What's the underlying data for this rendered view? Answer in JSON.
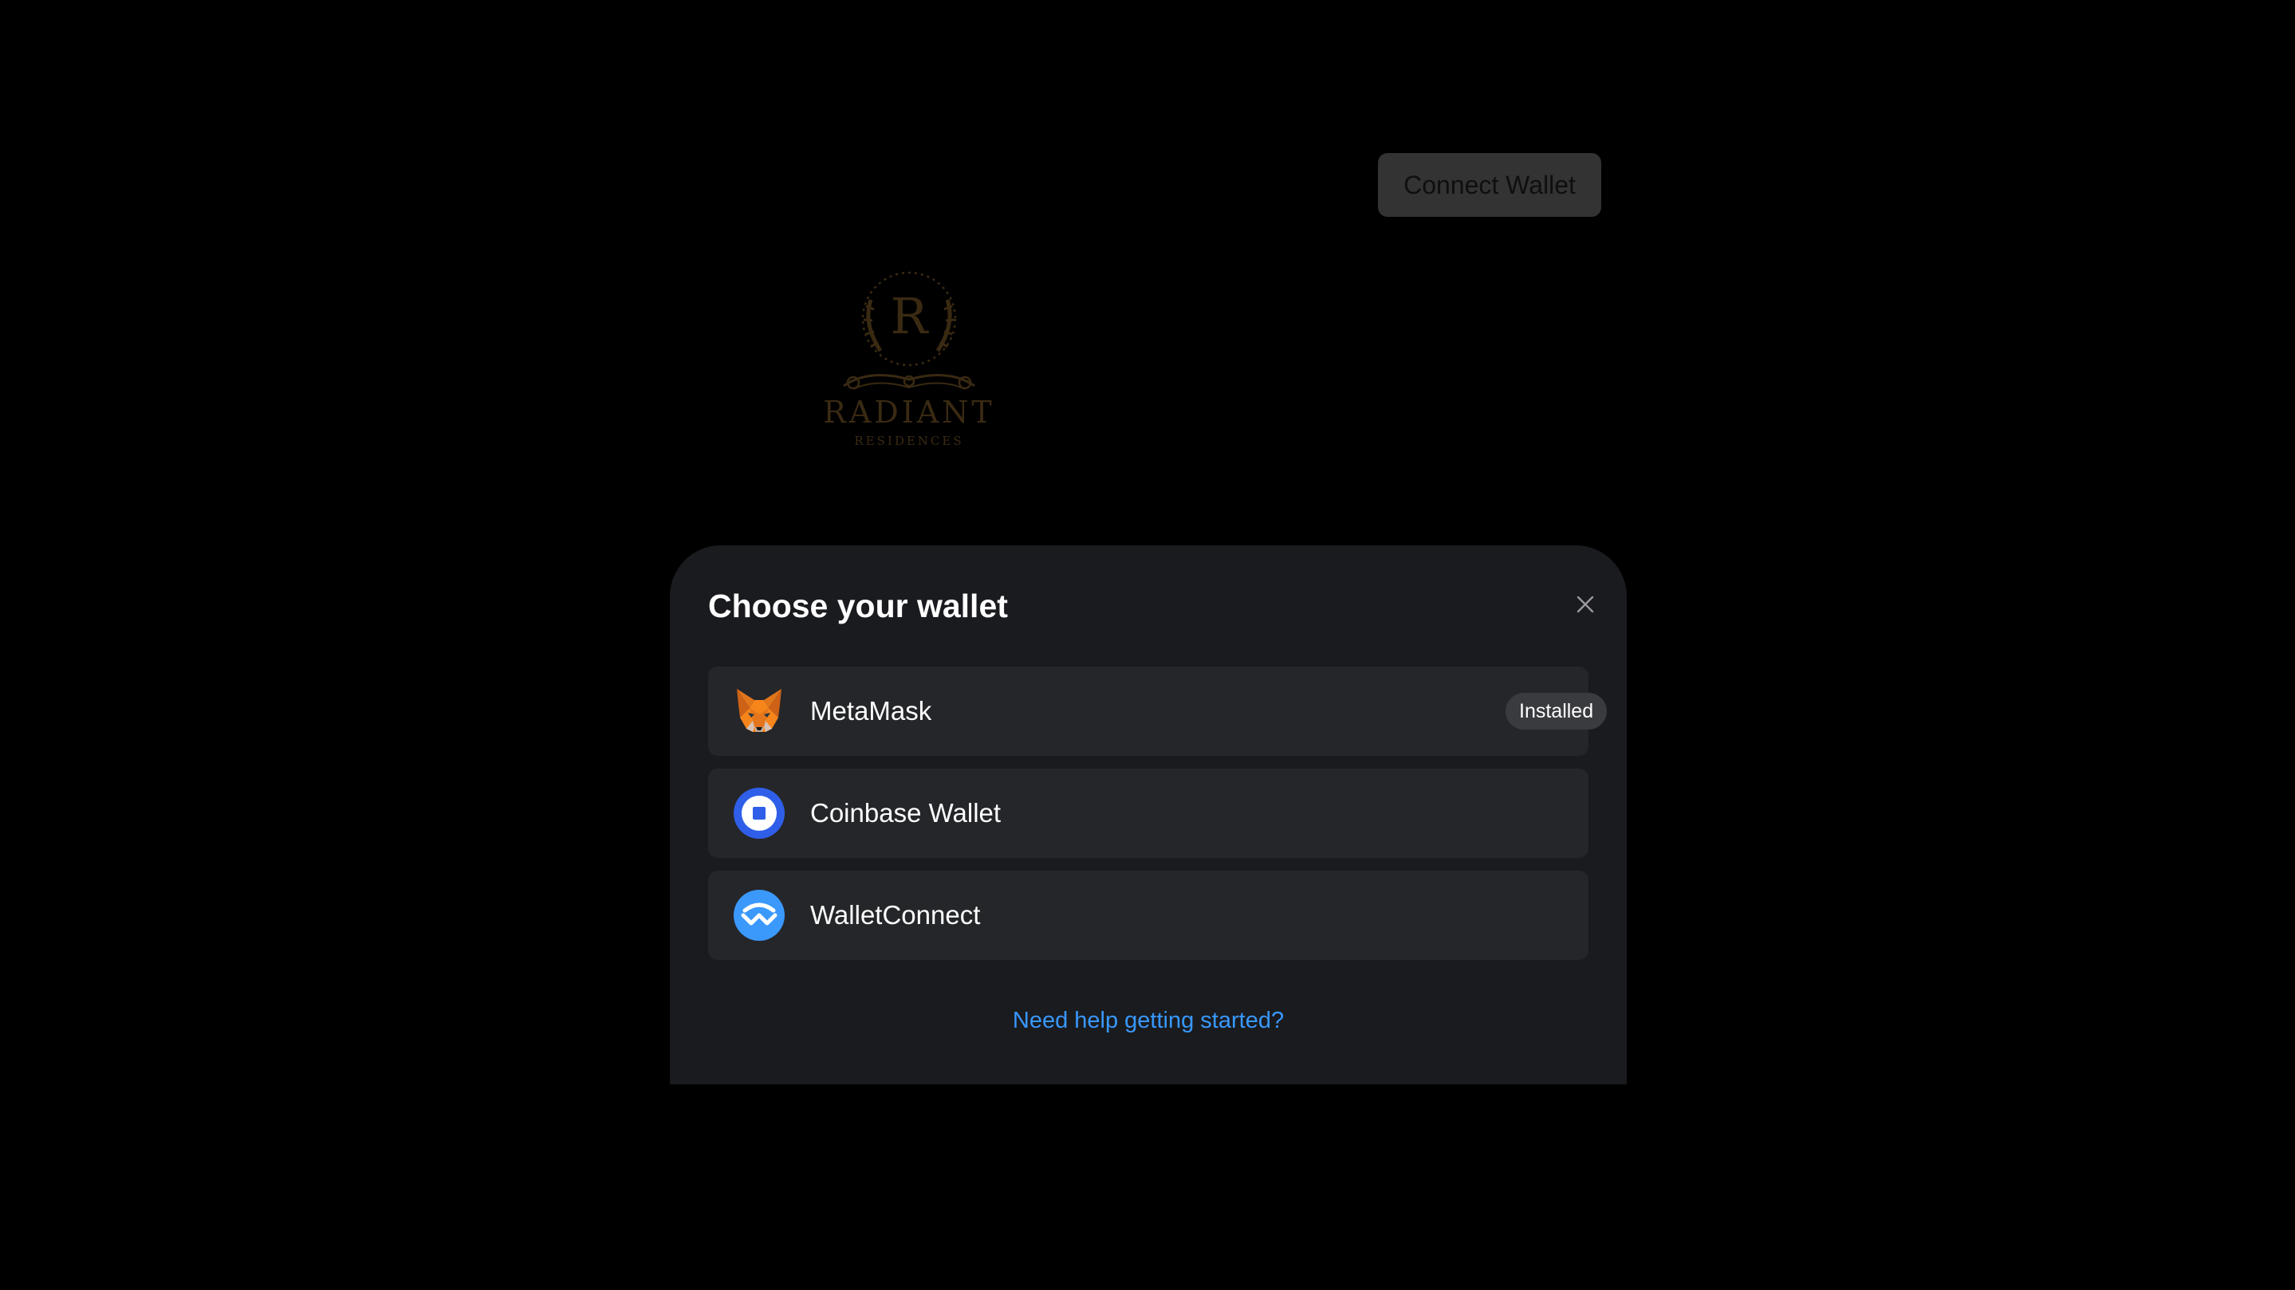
{
  "header": {
    "connect_wallet_label": "Connect Wallet"
  },
  "logo": {
    "monogram": "R",
    "name": "RADIANT",
    "subtitle": "RESIDENCES",
    "color": "#3a2a12"
  },
  "modal": {
    "title": "Choose your wallet",
    "close_icon": "close-icon",
    "wallets": [
      {
        "name": "MetaMask",
        "icon": "metamask-fox-icon",
        "badge": "Installed"
      },
      {
        "name": "Coinbase Wallet",
        "icon": "coinbase-icon",
        "badge": ""
      },
      {
        "name": "WalletConnect",
        "icon": "walletconnect-icon",
        "badge": ""
      }
    ],
    "help_link": "Need help getting started?"
  },
  "colors": {
    "background": "#000000",
    "modal_background": "#1a1b1f",
    "item_background": "#25262a",
    "link": "#3898ff",
    "coinbase_blue": "#2f5fe8",
    "walletconnect_blue": "#3b99fc",
    "metamask_orange": "#e2761b"
  }
}
